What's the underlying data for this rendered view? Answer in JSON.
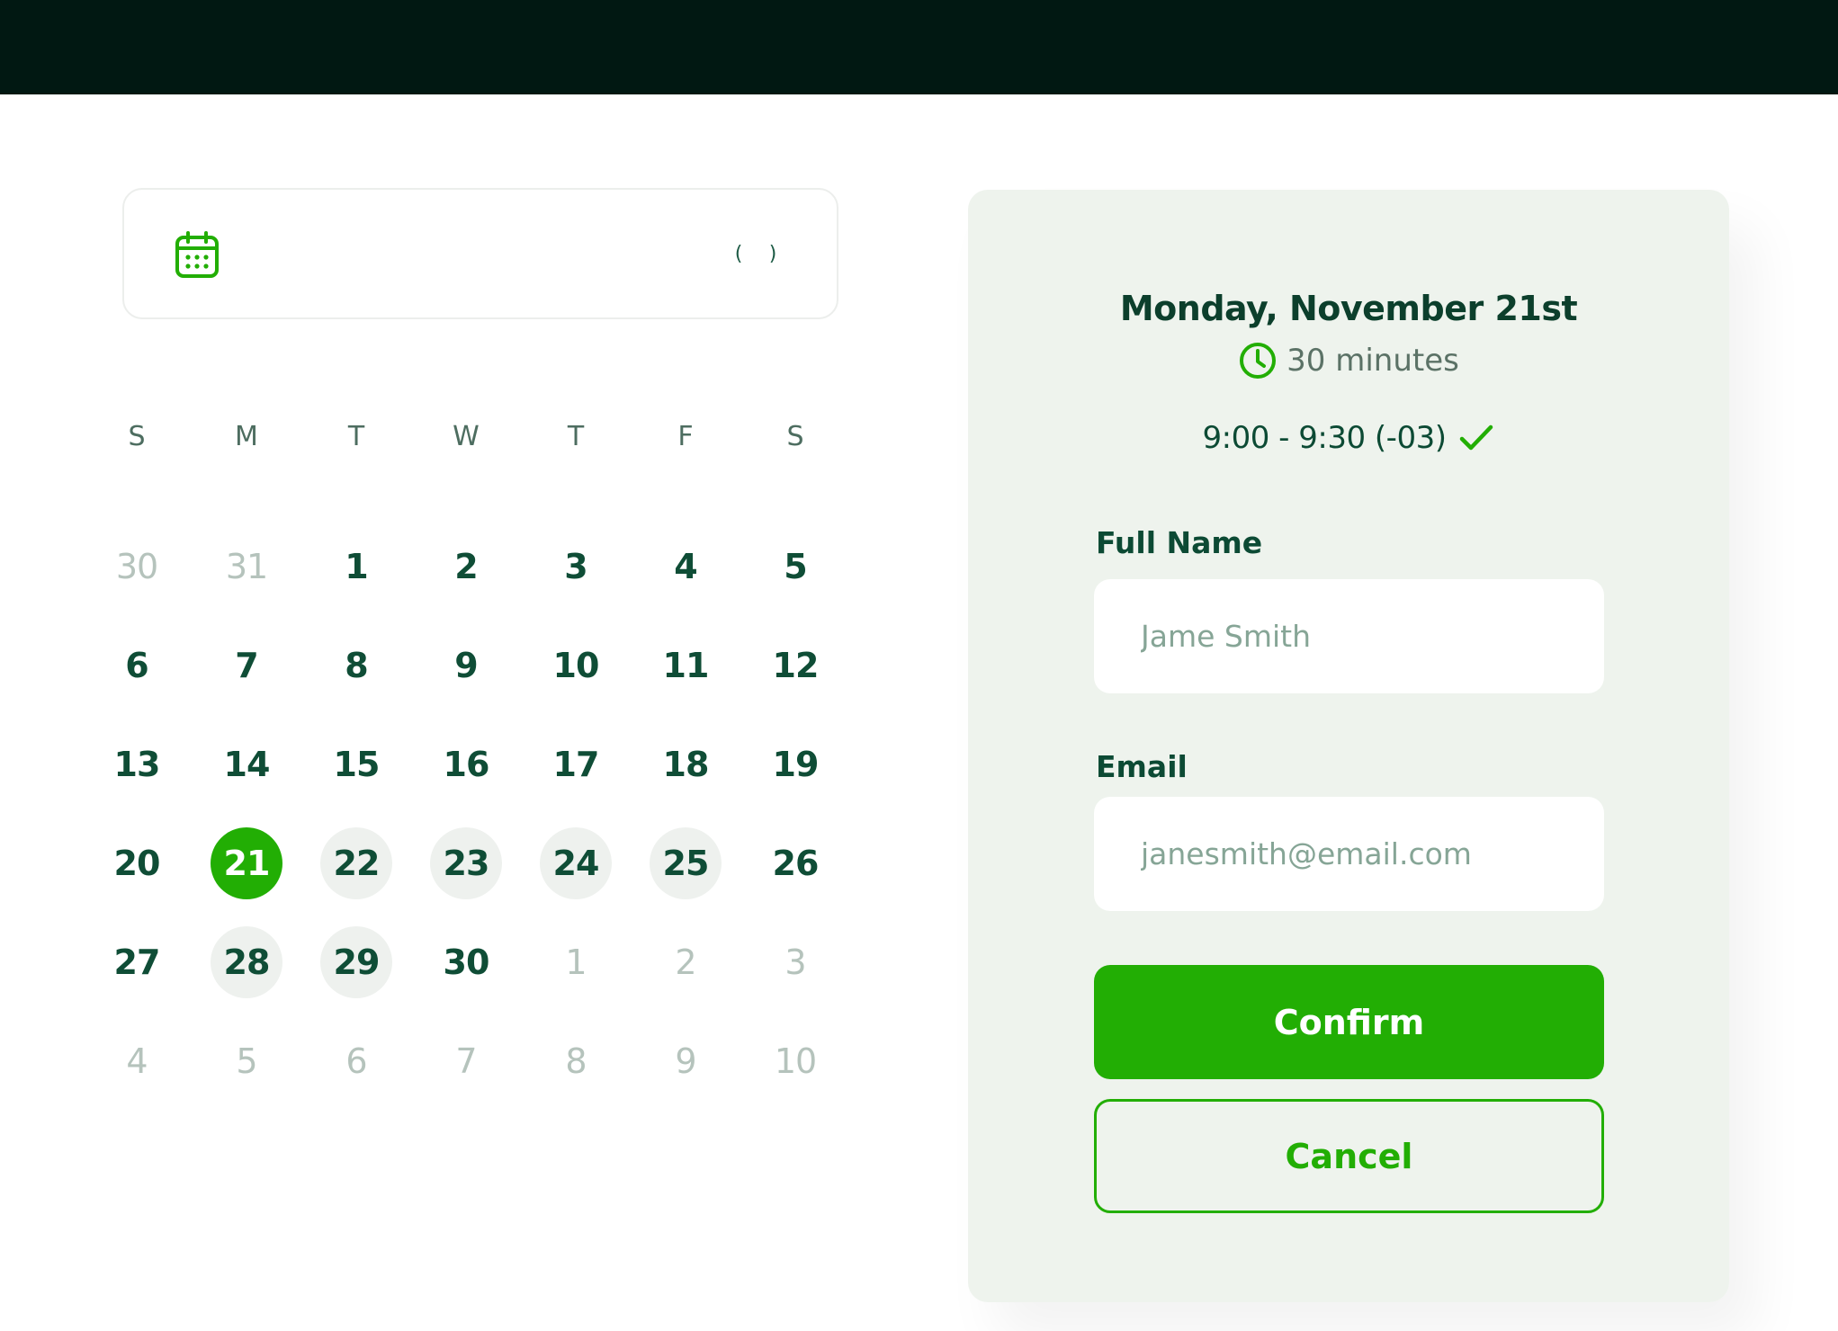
{
  "colors": {
    "accent": "#22ae04",
    "dark_text": "#0c4a34",
    "topbar": "#011812",
    "panel_bg": "#eef3ed",
    "available_day_bg": "#eef1ee",
    "muted_day": "#b5c3bc"
  },
  "calendar": {
    "icon": "calendar-icon",
    "nav": {
      "prev": "(",
      "next": ")"
    },
    "weekdays": [
      "S",
      "M",
      "T",
      "W",
      "T",
      "F",
      "S"
    ],
    "weeks": [
      [
        {
          "d": "30",
          "s": "muted"
        },
        {
          "d": "31",
          "s": "muted"
        },
        {
          "d": "1",
          "s": "normal"
        },
        {
          "d": "2",
          "s": "normal"
        },
        {
          "d": "3",
          "s": "normal"
        },
        {
          "d": "4",
          "s": "normal"
        },
        {
          "d": "5",
          "s": "normal"
        }
      ],
      [
        {
          "d": "6",
          "s": "normal"
        },
        {
          "d": "7",
          "s": "normal"
        },
        {
          "d": "8",
          "s": "normal"
        },
        {
          "d": "9",
          "s": "normal"
        },
        {
          "d": "10",
          "s": "normal"
        },
        {
          "d": "11",
          "s": "normal"
        },
        {
          "d": "12",
          "s": "normal"
        }
      ],
      [
        {
          "d": "13",
          "s": "normal"
        },
        {
          "d": "14",
          "s": "normal"
        },
        {
          "d": "15",
          "s": "normal"
        },
        {
          "d": "16",
          "s": "normal"
        },
        {
          "d": "17",
          "s": "normal"
        },
        {
          "d": "18",
          "s": "normal"
        },
        {
          "d": "19",
          "s": "normal"
        }
      ],
      [
        {
          "d": "20",
          "s": "normal"
        },
        {
          "d": "21",
          "s": "selected"
        },
        {
          "d": "22",
          "s": "available"
        },
        {
          "d": "23",
          "s": "available"
        },
        {
          "d": "24",
          "s": "available"
        },
        {
          "d": "25",
          "s": "available"
        },
        {
          "d": "26",
          "s": "normal"
        }
      ],
      [
        {
          "d": "27",
          "s": "normal"
        },
        {
          "d": "28",
          "s": "available"
        },
        {
          "d": "29",
          "s": "available"
        },
        {
          "d": "30",
          "s": "normal"
        },
        {
          "d": "1",
          "s": "muted"
        },
        {
          "d": "2",
          "s": "muted"
        },
        {
          "d": "3",
          "s": "muted"
        }
      ],
      [
        {
          "d": "4",
          "s": "muted"
        },
        {
          "d": "5",
          "s": "muted"
        },
        {
          "d": "6",
          "s": "muted"
        },
        {
          "d": "7",
          "s": "muted"
        },
        {
          "d": "8",
          "s": "muted"
        },
        {
          "d": "9",
          "s": "muted"
        },
        {
          "d": "10",
          "s": "muted"
        }
      ]
    ]
  },
  "booking": {
    "date": "Monday, November 21st",
    "duration_icon": "clock-icon",
    "duration": "30 minutes",
    "time_slot": "9:00 - 9:30 (-03)",
    "time_confirmed_icon": "checkmark-icon",
    "full_name": {
      "label": "Full Name",
      "value": "",
      "placeholder": "Jame Smith"
    },
    "email": {
      "label": "Email",
      "value": "",
      "placeholder": "janesmith@email.com"
    },
    "confirm_label": "Confirm",
    "cancel_label": "Cancel"
  }
}
